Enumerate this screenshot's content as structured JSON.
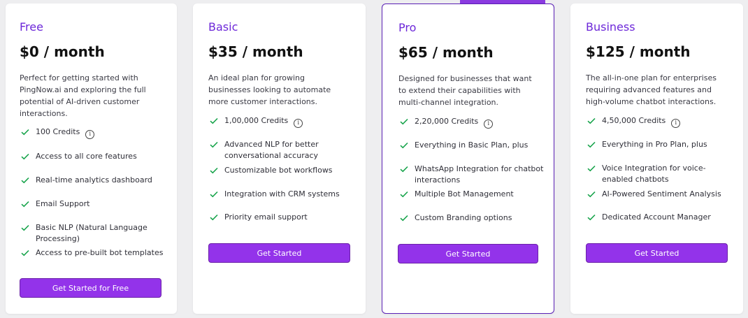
{
  "plans": [
    {
      "name": "Free",
      "price": "$0 / month",
      "description": "Perfect for getting started with PingNow.ai and exploring the full potential of AI-driven customer interactions.",
      "features": [
        "100 Credits",
        "Access to all core features",
        "Real-time analytics dashboard",
        "Email Support",
        "Basic NLP (Natural Language Processing)",
        "Access to pre-built bot templates"
      ],
      "button": "Get Started for Free"
    },
    {
      "name": "Basic",
      "price": "$35 / month",
      "description": "An ideal plan for growing businesses looking to automate more customer interactions.",
      "features": [
        "1,00,000 Credits",
        "Advanced NLP for better conversational accuracy",
        "Customizable bot workflows",
        "Integration with CRM systems",
        "Priority email support"
      ],
      "button": "Get Started"
    },
    {
      "name": "Pro",
      "price": "$65 / month",
      "description": "Designed for businesses that want to extend their capabilities with multi-channel integration.",
      "features": [
        "2,20,000 Credits",
        "Everything in Basic Plan, plus",
        "WhatsApp Integration for chatbot interactions",
        "Multiple Bot Management",
        "Custom Branding options"
      ],
      "button": "Get Started"
    },
    {
      "name": "Business",
      "price": "$125 / month",
      "description": "The all-in-one plan for enterprises requiring advanced features and high-volume chatbot interactions.",
      "features": [
        "4,50,000 Credits",
        "Everything in Pro Plan, plus",
        "Voice Integration for voice-enabled chatbots",
        "AI-Powered Sentiment Analysis",
        "Dedicated Account Manager"
      ],
      "button": "Get Started"
    }
  ],
  "info_icon_glyph": "i",
  "colors": {
    "accent": "#9333ea",
    "plan_name": "#6d28d9",
    "check": "#16a34a",
    "featured_border": "#5b21b6"
  }
}
